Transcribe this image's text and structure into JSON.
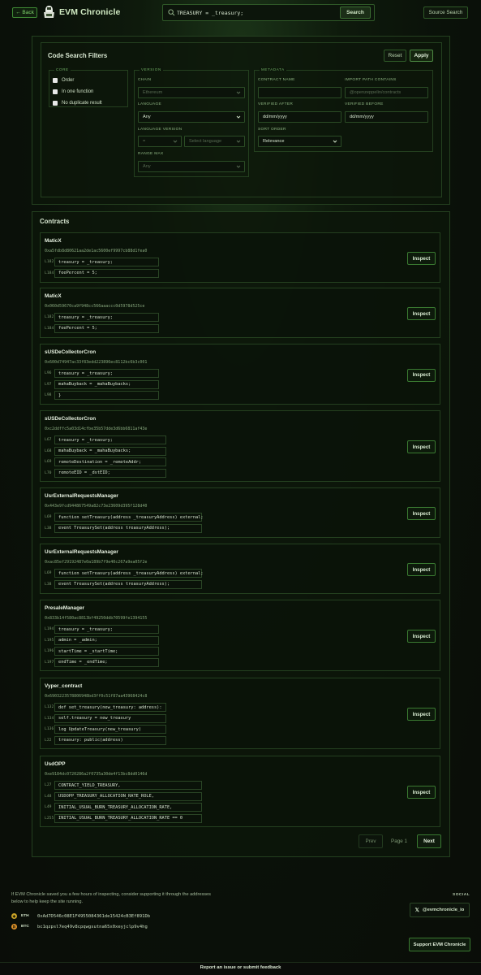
{
  "header": {
    "back_label": "← Back",
    "brand": "EVM Chronicle",
    "search_value": "TREASURY = _treasury;",
    "search_button": "Search",
    "source_button": "Source Search"
  },
  "filters": {
    "title": "Code Search Filters",
    "reset": "Reset",
    "apply": "Apply",
    "core": {
      "title": "CORE",
      "options": [
        "Order",
        "In one function",
        "No duplicate result"
      ]
    },
    "version": {
      "title": "VERSION",
      "chain_label": "CHAIN",
      "chain_value": "Ethereum",
      "language_label": "LANGUAGE",
      "language_value": "Any",
      "language_version_label": "LANGUAGE VERSION",
      "language_version_op": "=",
      "language_version_placeholder": "Select language",
      "range_max_label": "RANGE MAX",
      "range_max_value": "Any"
    },
    "metadata": {
      "title": "METADATA",
      "contract_name_label": "CONTRACT NAME",
      "contract_name_value": "",
      "import_path_label": "IMPORT PATH CONTAINS",
      "import_path_placeholder": "@openzeppelin/contracts",
      "verified_after_label": "VERIFIED AFTER",
      "verified_after_value": "dd/mm/yyyy",
      "verified_before_label": "VERIFIED BEFORE",
      "verified_before_value": "dd/mm/yyyy",
      "sort_order_label": "SORT ORDER",
      "sort_order_value": "Relevance"
    }
  },
  "contracts": {
    "title": "Contracts",
    "inspect_label": "Inspect",
    "items": [
      {
        "name": "MaticX",
        "address": "0xa5fdb8d80621aa2de1ac5600ef9997cb88d1fea0",
        "lines": [
          {
            "no": "L182",
            "code": "treasury = _treasury;"
          },
          {
            "no": "L184",
            "code": "feePercent = 5;"
          }
        ]
      },
      {
        "name": "MaticX",
        "address": "0x060d59670ca9f948cc566aaaccc0d5978d525ce",
        "lines": [
          {
            "no": "L182",
            "code": "treasury = _treasury;"
          },
          {
            "no": "L184",
            "code": "feePercent = 5;"
          }
        ]
      },
      {
        "name": "sUSDeCollectorCron",
        "address": "0x600d74947ac33f83edd223896ec8112bc6b3c001",
        "lines": [
          {
            "no": "L96",
            "code": "treasury = _treasury;"
          },
          {
            "no": "L97",
            "code": "mahaBuyback = _mahaBuybacks;"
          },
          {
            "no": "L98",
            "code": "}"
          }
        ]
      },
      {
        "name": "sUSDeCollectorCron",
        "address": "0xc2ddffc5a03d14cfbe35b57dde3d6bb6811af43e",
        "lines": [
          {
            "no": "L67",
            "code": "treasury = _treasury;"
          },
          {
            "no": "L68",
            "code": "mahaBuyback = _mahaBuybacks;"
          },
          {
            "no": "L69",
            "code": "remoteDestination = _remoteAddr;"
          },
          {
            "no": "L70",
            "code": "remoteEID = _dstEID;"
          }
        ]
      },
      {
        "name": "UsrExternalRequestsManager",
        "address": "0x443e9fcd944867549a82c73e23609d395f128d40",
        "lines": [
          {
            "no": "L69",
            "code": "function setTreasury(address _treasuryAddress) external;"
          },
          {
            "no": "L38",
            "code": "event TreasurySet(address treasuryAddress);"
          }
        ]
      },
      {
        "name": "UsrExternalRequestsManager",
        "address": "0xac85ef29192487e0a189b7f9e40c267a9ea05f2e",
        "lines": [
          {
            "no": "L69",
            "code": "function setTreasury(address _treasuryAddress) external;"
          },
          {
            "no": "L38",
            "code": "event TreasurySet(address treasuryAddress);"
          }
        ]
      },
      {
        "name": "PresaleManager",
        "address": "0x833b14f580ac8813bf49250ddb70599fe1394155",
        "lines": [
          {
            "no": "L194",
            "code": "treasury = _treasury;"
          },
          {
            "no": "L195",
            "code": "admin = _admin;"
          },
          {
            "no": "L196",
            "code": "startTime = _startTime;"
          },
          {
            "no": "L197",
            "code": "endTime = _endTime;"
          }
        ]
      },
      {
        "name": "Vyper_contract",
        "address": "0x6903223578806948bd3ff0c51f87aa43968424c8",
        "lines": [
          {
            "no": "L132",
            "code": "def set_treasury(new_treasury: address):"
          },
          {
            "no": "L134",
            "code": "self.treasury = new_treasury"
          },
          {
            "no": "L136",
            "code": "log UpdateTreasury(new_treasury)"
          },
          {
            "no": "L22",
            "code": "treasury: public(address)"
          }
        ]
      },
      {
        "name": "UsdOPP",
        "address": "0xe9184dc0720286a2f0735a30de4f13bc8dd0146d",
        "lines": [
          {
            "no": "L27",
            "code": "CONTRACT_YIELD_TREASURY,"
          },
          {
            "no": "L48",
            "code": "USDOPP_TREASURY_ALLOCATION_RATE_ROLE,"
          },
          {
            "no": "L49",
            "code": "INITIAL_USUAL_BURN_TREASURY_ALLOCATION_RATE,"
          },
          {
            "no": "L255",
            "code": "INITIAL_USUAL_BURN_TREASURY_ALLOCATION_RATE == 0"
          }
        ]
      }
    ]
  },
  "pagination": {
    "prev": "Prev",
    "page": "Page 1",
    "next": "Next"
  },
  "footer": {
    "support_text": "If EVM Chronicle saved you a few hours of inspecting, consider supporting it through the addresses below to help keep the site running.",
    "social_label": "SOCIAL",
    "x_handle": "@evmchronicle_io",
    "eth_tag": "ETH",
    "eth_address": "0xAd7D546c08E1F4955084361de15424cB3Ef891Db",
    "btc_tag": "BTC",
    "btc_address": "bc1qzpsl7eq49v8cpqwgsutna65x0xeyjclp9v4hg",
    "support_button": "Support EVM Chronicle",
    "report_link": "Report an issue or submit feedback"
  },
  "colors": {
    "accent": "#3f8a35",
    "eth_coin": "#c9a227",
    "btc_coin": "#e0932a"
  }
}
